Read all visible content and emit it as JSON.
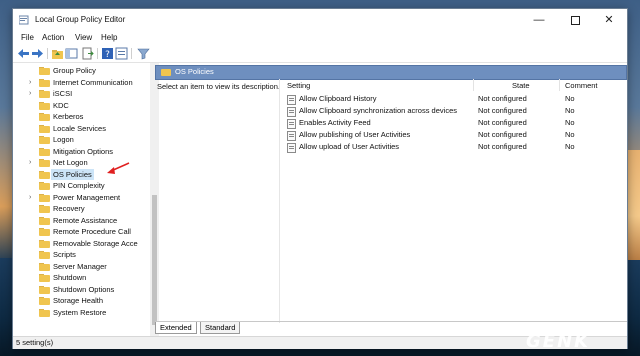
{
  "window": {
    "title": "Local Group Policy Editor"
  },
  "menu": [
    "File",
    "Action",
    "View",
    "Help"
  ],
  "toolbar": {
    "icons": [
      "back-arrow-icon",
      "forward-arrow-icon",
      "up-folder-icon",
      "show-hide-tree-icon",
      "export-list-icon",
      "help-icon",
      "properties-icon",
      "filter-icon"
    ]
  },
  "tree": {
    "items": [
      {
        "label": "Group Policy",
        "expandable": false
      },
      {
        "label": "Internet Communication",
        "expandable": true
      },
      {
        "label": "iSCSI",
        "expandable": true
      },
      {
        "label": "KDC",
        "expandable": false
      },
      {
        "label": "Kerberos",
        "expandable": false
      },
      {
        "label": "Locale Services",
        "expandable": false
      },
      {
        "label": "Logon",
        "expandable": false
      },
      {
        "label": "Mitigation Options",
        "expandable": false
      },
      {
        "label": "Net Logon",
        "expandable": true
      },
      {
        "label": "OS Policies",
        "expandable": false,
        "selected": true
      },
      {
        "label": "PIN Complexity",
        "expandable": false
      },
      {
        "label": "Power Management",
        "expandable": true
      },
      {
        "label": "Recovery",
        "expandable": false
      },
      {
        "label": "Remote Assistance",
        "expandable": false
      },
      {
        "label": "Remote Procedure Call",
        "expandable": false
      },
      {
        "label": "Removable Storage Acce",
        "expandable": false
      },
      {
        "label": "Scripts",
        "expandable": false
      },
      {
        "label": "Server Manager",
        "expandable": false
      },
      {
        "label": "Shutdown",
        "expandable": false
      },
      {
        "label": "Shutdown Options",
        "expandable": false
      },
      {
        "label": "Storage Health",
        "expandable": false
      },
      {
        "label": "System Restore",
        "expandable": false
      }
    ]
  },
  "pane": {
    "header_title": "OS Policies",
    "description": "Select an item to view its description.",
    "columns": {
      "setting": "Setting",
      "state": "State",
      "comment": "Comment"
    },
    "rows": [
      {
        "setting": "Allow Clipboard History",
        "state": "Not configured",
        "comment": "No"
      },
      {
        "setting": "Allow Clipboard synchronization across devices",
        "state": "Not configured",
        "comment": "No"
      },
      {
        "setting": "Enables Activity Feed",
        "state": "Not configured",
        "comment": "No"
      },
      {
        "setting": "Allow publishing of User Activities",
        "state": "Not configured",
        "comment": "No"
      },
      {
        "setting": "Allow upload of User Activities",
        "state": "Not configured",
        "comment": "No"
      }
    ]
  },
  "tabs": {
    "extended": "Extended",
    "standard": "Standard"
  },
  "status": {
    "text": "5 setting(s)"
  },
  "watermark": {
    "text": "GENK"
  },
  "colors": {
    "accent": "#6e8fbf",
    "folder": "#f0c54f",
    "annotation_arrow": "#e02020",
    "selection": "#cce4f7"
  }
}
